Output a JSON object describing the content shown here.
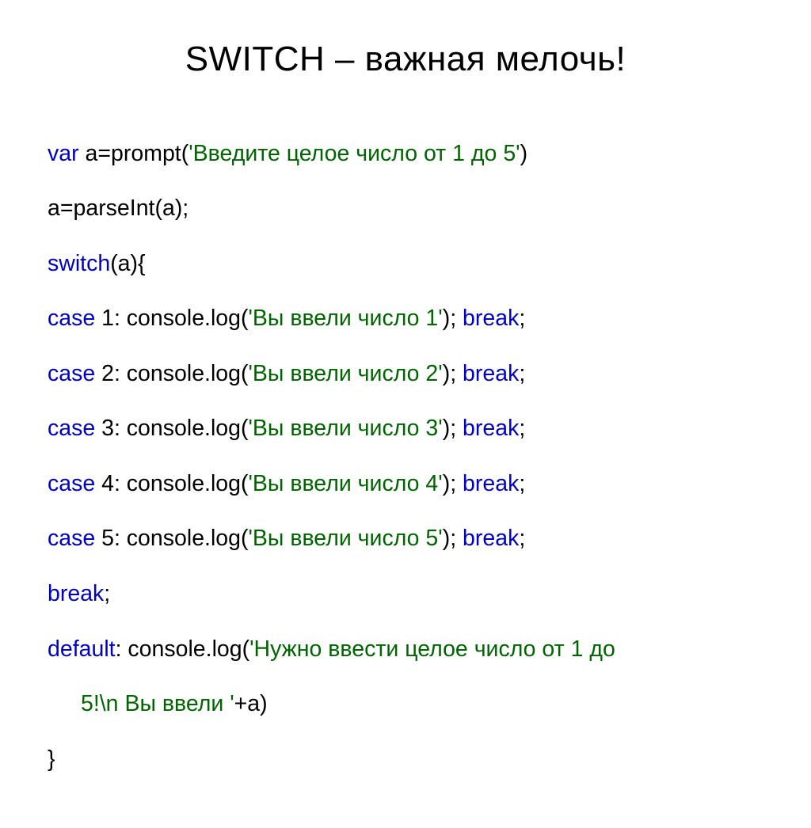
{
  "title": "SWITCH – важная мелочь!",
  "code": {
    "l1_kw1": "var",
    "l1_p1": " a=prompt(",
    "l1_s1": "'Введите целое число от 1 до 5'",
    "l1_p2": ")",
    "l2": "a=parseInt(a);",
    "l3_kw1": "switch",
    "l3_p1": "(a){",
    "l4_kw1": "case",
    "l4_p1": " 1: console.log(",
    "l4_s1": "'Вы ввели число 1'",
    "l4_p2": "); ",
    "l4_kw2": "break",
    "l4_p3": ";",
    "l5_kw1": "case",
    "l5_p1": " 2: console.log(",
    "l5_s1": "'Вы ввели число 2'",
    "l5_p2": "); ",
    "l5_kw2": "break",
    "l5_p3": ";",
    "l6_kw1": "case",
    "l6_p1": " 3: console.log(",
    "l6_s1": "'Вы ввели число 3'",
    "l6_p2": "); ",
    "l6_kw2": "break",
    "l6_p3": ";",
    "l7_kw1": "case",
    "l7_p1": " 4: console.log(",
    "l7_s1": "'Вы ввели число 4'",
    "l7_p2": "); ",
    "l7_kw2": "break",
    "l7_p3": ";",
    "l8_kw1": "case",
    "l8_p1": " 5: console.log(",
    "l8_s1": "'Вы ввели число 5'",
    "l8_p2": "); ",
    "l8_kw2": "break",
    "l8_p3": ";",
    "l9_kw1": "break",
    "l9_p1": ";",
    "l10_kw1": "default",
    "l10_p1": ": console.log(",
    "l10_s1": "'Нужно ввести целое число от 1 до ",
    "l11_s1": "5!\\n Вы ввели '",
    "l11_p1": "+a)",
    "l12": "}"
  }
}
